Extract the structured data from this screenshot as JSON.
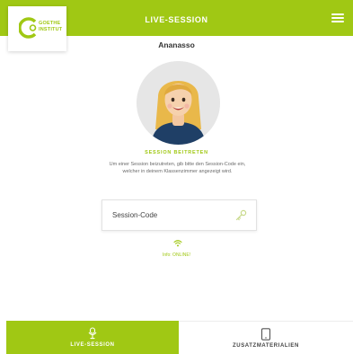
{
  "header": {
    "title": "LIVE-SESSION",
    "menu_icon": "hamburger-menu-icon"
  },
  "logo": {
    "line1": "GOETHE",
    "line2": "INSTITUT",
    "icon": "goethe-logo-mark"
  },
  "user": {
    "name": "Ananasso",
    "avatar_icon": "user-avatar-illustration"
  },
  "join": {
    "heading": "SESSION BEITRETEN",
    "instructions": "Um einer Session beizutreten, gib bitte den Session-Code ein, welcher in deinem Klassenzimmer angezeigt wird.",
    "input_placeholder": "Session-Code",
    "input_icon": "key-icon"
  },
  "connection": {
    "status": "Info: ONLINE!",
    "icon": "wifi-icon"
  },
  "tabs": [
    {
      "label": "LIVE-SESSION",
      "icon": "live-session-icon",
      "active": true
    },
    {
      "label": "ZUSATZMATERIALIEN",
      "icon": "tablet-icon",
      "active": false
    }
  ],
  "colors": {
    "accent": "#a0c814",
    "text": "#333333",
    "muted": "#6b6b6b"
  }
}
